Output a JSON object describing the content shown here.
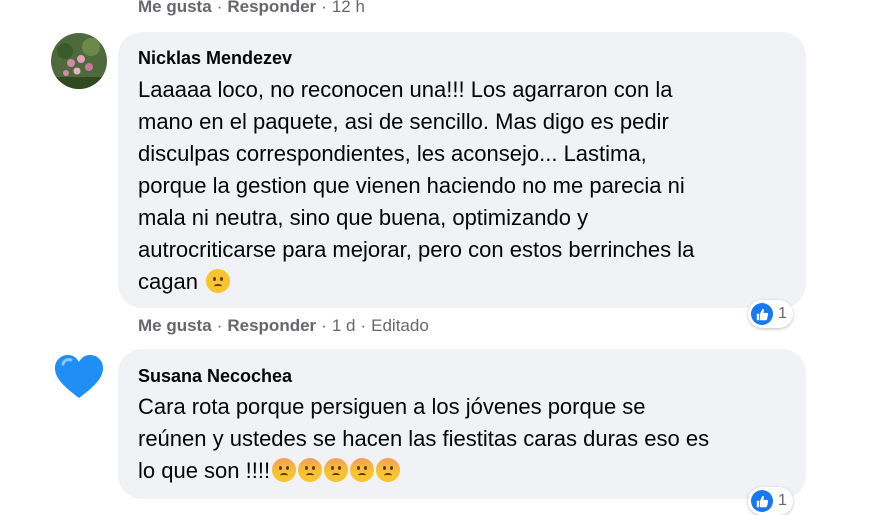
{
  "top_actions": {
    "like": "Me gusta",
    "reply": "Responder",
    "time": "12 h"
  },
  "comments": [
    {
      "author": "Nicklas Mendezev",
      "lines": [
        "Laaaaa loco, no reconocen una!!! Los agarraron con la",
        "mano en el paquete, asi de sencillo. Mas digo es pedir",
        "disculpas correspondientes, les aconsejo... Lastima,",
        "porque la gestion que vienen haciendo no me parecia ni",
        "mala ni neutra, sino que buena, optimizando y",
        "autrocriticarse para mejorar, pero con estos berrinches la",
        "cagan"
      ],
      "emoji": "confused-face",
      "reaction_count": "1",
      "actions": {
        "like": "Me gusta",
        "reply": "Responder",
        "time": "1 d",
        "edited": "Editado"
      }
    },
    {
      "author": "Susana Necochea",
      "lines": [
        "Cara rota porque persiguen a los jóvenes porque se",
        "reúnen y ustedes se hacen las fiestitas caras duras eso es",
        "lo que son !!!!"
      ],
      "emoji": "angry-face",
      "emoji_count": 5,
      "reaction_count": "1"
    }
  ],
  "colors": {
    "bubble": "#f0f2f5",
    "meta": "#65676b",
    "like_blue": "#1877f2",
    "heart": "#1f8ff5"
  }
}
